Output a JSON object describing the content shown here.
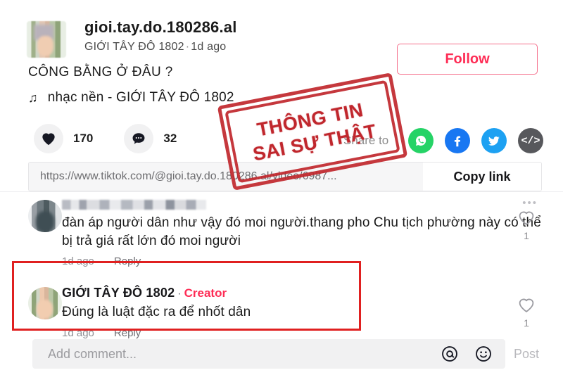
{
  "header": {
    "handle": "gioi.tay.do.180286.al",
    "display_name": "GIỚI TÂY ĐÔ 1802",
    "separator": "·",
    "timestamp": "1d ago",
    "follow_label": "Follow",
    "avatar_name": "blurred-profile-avatar"
  },
  "post": {
    "caption": "CÔNG BẰNG Ở ĐÂU ?",
    "music_note_glyph": "♫",
    "music_label": "nhạc nền - GIỚI TÂY ĐÔ 1802"
  },
  "stats": {
    "like_count": "170",
    "comment_count": "32",
    "like_icon": "heart-filled-icon",
    "comment_icon": "speech-bubble-icon"
  },
  "share": {
    "share_to_label": "Share to",
    "icons": [
      {
        "name": "whatsapp-icon",
        "color": "#25D366"
      },
      {
        "name": "facebook-icon",
        "color": "#1877F2"
      },
      {
        "name": "twitter-icon",
        "color": "#1DA1F2"
      },
      {
        "name": "embed-code-icon",
        "color": "#57585c",
        "glyph": "</>"
      }
    ]
  },
  "url_bar": {
    "url": "https://www.tiktok.com/@gioi.tay.do.180286.al/video/6987...",
    "copy_label": "Copy link"
  },
  "stamp": {
    "line1": "THÔNG TIN",
    "line2": "SAI SỰ THẬT",
    "color": "#c0272d"
  },
  "comments": [
    {
      "author": "",
      "author_blurred": true,
      "is_creator": false,
      "text": "đàn áp người dân như vậy đó moi người.thang pho Chu tịch phường này có thể bị trả giá rất lớn đó moi người",
      "time": "1d ago",
      "reply_label": "Reply",
      "like_count": "1",
      "more_glyph": "•••"
    },
    {
      "author": "GIỚI TÂY ĐÔ 1802",
      "author_blurred": false,
      "is_creator": true,
      "creator_label": "Creator",
      "separator": "·",
      "text": "Đúng là luật đặc ra để nhốt dân",
      "time": "1d ago",
      "reply_label": "Reply",
      "like_count": "1"
    }
  ],
  "composer": {
    "placeholder": "Add comment...",
    "mention_icon": "at-mention-icon",
    "emoji_icon": "smiley-face-icon",
    "post_label": "Post"
  },
  "highlight": {
    "color": "#e02020"
  }
}
